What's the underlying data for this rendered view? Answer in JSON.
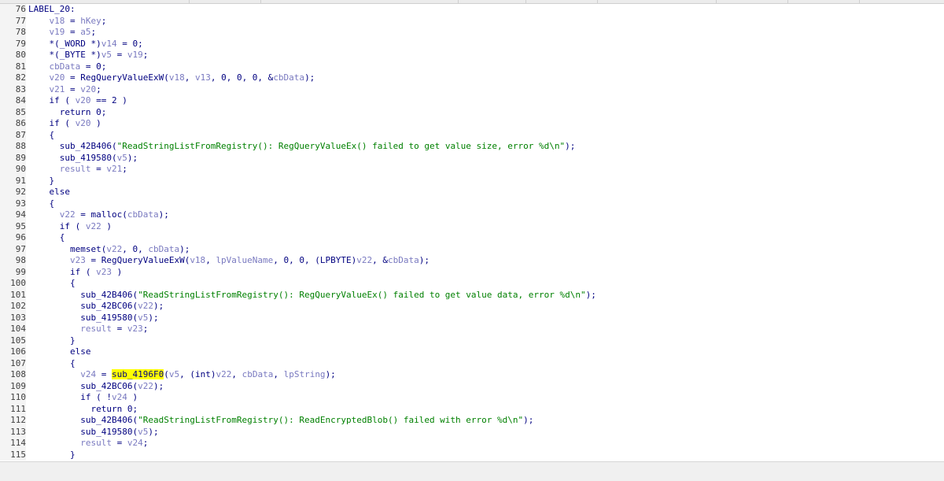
{
  "colors": {
    "string": "#008000",
    "variable": "#7a7ac0",
    "code": "#000080",
    "highlight": "#ffff00",
    "breakpoint_dot": "#3fa9e6"
  },
  "lines": [
    {
      "num": "76",
      "dot": false,
      "tokens": [
        [
          "id",
          "LABEL_20:"
        ]
      ]
    },
    {
      "num": "77",
      "dot": true,
      "tokens": [
        [
          "p",
          "    "
        ],
        [
          "var",
          "v18"
        ],
        [
          "p",
          " = "
        ],
        [
          "var",
          "hKey"
        ],
        [
          "p",
          ";"
        ]
      ]
    },
    {
      "num": "78",
      "dot": true,
      "tokens": [
        [
          "p",
          "    "
        ],
        [
          "var",
          "v19"
        ],
        [
          "p",
          " = "
        ],
        [
          "var",
          "a5"
        ],
        [
          "p",
          ";"
        ]
      ]
    },
    {
      "num": "79",
      "dot": true,
      "tokens": [
        [
          "p",
          "    *(_WORD *)"
        ],
        [
          "var",
          "v14"
        ],
        [
          "p",
          " = 0;"
        ]
      ]
    },
    {
      "num": "80",
      "dot": true,
      "tokens": [
        [
          "p",
          "    *(_BYTE *)"
        ],
        [
          "var",
          "v5"
        ],
        [
          "p",
          " = "
        ],
        [
          "var",
          "v19"
        ],
        [
          "p",
          ";"
        ]
      ]
    },
    {
      "num": "81",
      "dot": true,
      "tokens": [
        [
          "p",
          "    "
        ],
        [
          "var",
          "cbData"
        ],
        [
          "p",
          " = 0;"
        ]
      ]
    },
    {
      "num": "82",
      "dot": true,
      "tokens": [
        [
          "p",
          "    "
        ],
        [
          "var",
          "v20"
        ],
        [
          "p",
          " = RegQueryValueExW("
        ],
        [
          "var",
          "v18"
        ],
        [
          "p",
          ", "
        ],
        [
          "var",
          "v13"
        ],
        [
          "p",
          ", 0, 0, 0, &"
        ],
        [
          "var",
          "cbData"
        ],
        [
          "p",
          ");"
        ]
      ]
    },
    {
      "num": "83",
      "dot": true,
      "tokens": [
        [
          "p",
          "    "
        ],
        [
          "var",
          "v21"
        ],
        [
          "p",
          " = "
        ],
        [
          "var",
          "v20"
        ],
        [
          "p",
          ";"
        ]
      ]
    },
    {
      "num": "84",
      "dot": true,
      "tokens": [
        [
          "p",
          "    if ( "
        ],
        [
          "var",
          "v20"
        ],
        [
          "p",
          " == 2 )"
        ]
      ]
    },
    {
      "num": "85",
      "dot": true,
      "tokens": [
        [
          "p",
          "      return 0;"
        ]
      ]
    },
    {
      "num": "86",
      "dot": true,
      "tokens": [
        [
          "p",
          "    if ( "
        ],
        [
          "var",
          "v20"
        ],
        [
          "p",
          " )"
        ]
      ]
    },
    {
      "num": "87",
      "dot": false,
      "tokens": [
        [
          "p",
          "    {"
        ]
      ]
    },
    {
      "num": "88",
      "dot": true,
      "tokens": [
        [
          "p",
          "      sub_42B406("
        ],
        [
          "str",
          "\"ReadStringListFromRegistry(): RegQueryValueEx() failed to get value size, error %d\\n\""
        ],
        [
          "p",
          ");"
        ]
      ]
    },
    {
      "num": "89",
      "dot": true,
      "tokens": [
        [
          "p",
          "      sub_419580("
        ],
        [
          "var",
          "v5"
        ],
        [
          "p",
          ");"
        ]
      ]
    },
    {
      "num": "90",
      "dot": true,
      "tokens": [
        [
          "p",
          "      "
        ],
        [
          "var",
          "result"
        ],
        [
          "p",
          " = "
        ],
        [
          "var",
          "v21"
        ],
        [
          "p",
          ";"
        ]
      ]
    },
    {
      "num": "91",
      "dot": false,
      "tokens": [
        [
          "p",
          "    }"
        ]
      ]
    },
    {
      "num": "92",
      "dot": false,
      "tokens": [
        [
          "p",
          "    else"
        ]
      ]
    },
    {
      "num": "93",
      "dot": false,
      "tokens": [
        [
          "p",
          "    {"
        ]
      ]
    },
    {
      "num": "94",
      "dot": true,
      "tokens": [
        [
          "p",
          "      "
        ],
        [
          "var",
          "v22"
        ],
        [
          "p",
          " = malloc("
        ],
        [
          "var",
          "cbData"
        ],
        [
          "p",
          ");"
        ]
      ]
    },
    {
      "num": "95",
      "dot": true,
      "tokens": [
        [
          "p",
          "      if ( "
        ],
        [
          "var",
          "v22"
        ],
        [
          "p",
          " )"
        ]
      ]
    },
    {
      "num": "96",
      "dot": false,
      "tokens": [
        [
          "p",
          "      {"
        ]
      ]
    },
    {
      "num": "97",
      "dot": true,
      "tokens": [
        [
          "p",
          "        memset("
        ],
        [
          "var",
          "v22"
        ],
        [
          "p",
          ", 0, "
        ],
        [
          "var",
          "cbData"
        ],
        [
          "p",
          ");"
        ]
      ]
    },
    {
      "num": "98",
      "dot": true,
      "tokens": [
        [
          "p",
          "        "
        ],
        [
          "var",
          "v23"
        ],
        [
          "p",
          " = RegQueryValueExW("
        ],
        [
          "var",
          "v18"
        ],
        [
          "p",
          ", "
        ],
        [
          "var",
          "lpValueName"
        ],
        [
          "p",
          ", 0, 0, (LPBYTE)"
        ],
        [
          "var",
          "v22"
        ],
        [
          "p",
          ", &"
        ],
        [
          "var",
          "cbData"
        ],
        [
          "p",
          ");"
        ]
      ]
    },
    {
      "num": "99",
      "dot": true,
      "tokens": [
        [
          "p",
          "        if ( "
        ],
        [
          "var",
          "v23"
        ],
        [
          "p",
          " )"
        ]
      ]
    },
    {
      "num": "100",
      "dot": false,
      "tokens": [
        [
          "p",
          "        {"
        ]
      ]
    },
    {
      "num": "101",
      "dot": true,
      "tokens": [
        [
          "p",
          "          sub_42B406("
        ],
        [
          "str",
          "\"ReadStringListFromRegistry(): RegQueryValueEx() failed to get value data, error %d\\n\""
        ],
        [
          "p",
          ");"
        ]
      ]
    },
    {
      "num": "102",
      "dot": true,
      "tokens": [
        [
          "p",
          "          sub_42BC06("
        ],
        [
          "var",
          "v22"
        ],
        [
          "p",
          ");"
        ]
      ]
    },
    {
      "num": "103",
      "dot": true,
      "tokens": [
        [
          "p",
          "          sub_419580("
        ],
        [
          "var",
          "v5"
        ],
        [
          "p",
          ");"
        ]
      ]
    },
    {
      "num": "104",
      "dot": true,
      "tokens": [
        [
          "p",
          "          "
        ],
        [
          "var",
          "result"
        ],
        [
          "p",
          " = "
        ],
        [
          "var",
          "v23"
        ],
        [
          "p",
          ";"
        ]
      ]
    },
    {
      "num": "105",
      "dot": false,
      "tokens": [
        [
          "p",
          "        }"
        ]
      ]
    },
    {
      "num": "106",
      "dot": false,
      "tokens": [
        [
          "p",
          "        else"
        ]
      ]
    },
    {
      "num": "107",
      "dot": false,
      "tokens": [
        [
          "p",
          "        {"
        ]
      ]
    },
    {
      "num": "108",
      "dot": true,
      "tokens": [
        [
          "p",
          "          "
        ],
        [
          "var",
          "v24"
        ],
        [
          "p",
          " = "
        ],
        [
          "hl",
          "sub_4196F0"
        ],
        [
          "p",
          "("
        ],
        [
          "var",
          "v5"
        ],
        [
          "p",
          ", (int)"
        ],
        [
          "var",
          "v22"
        ],
        [
          "p",
          ", "
        ],
        [
          "var",
          "cbData"
        ],
        [
          "p",
          ", "
        ],
        [
          "var",
          "lpString"
        ],
        [
          "p",
          ");"
        ]
      ]
    },
    {
      "num": "109",
      "dot": true,
      "tokens": [
        [
          "p",
          "          sub_42BC06("
        ],
        [
          "var",
          "v22"
        ],
        [
          "p",
          ");"
        ]
      ]
    },
    {
      "num": "110",
      "dot": true,
      "tokens": [
        [
          "p",
          "          if ( !"
        ],
        [
          "var",
          "v24"
        ],
        [
          "p",
          " )"
        ]
      ]
    },
    {
      "num": "111",
      "dot": true,
      "tokens": [
        [
          "p",
          "            return 0;"
        ]
      ]
    },
    {
      "num": "112",
      "dot": true,
      "tokens": [
        [
          "p",
          "          sub_42B406("
        ],
        [
          "str",
          "\"ReadStringListFromRegistry(): ReadEncryptedBlob() failed with error %d\\n\""
        ],
        [
          "p",
          ");"
        ]
      ]
    },
    {
      "num": "113",
      "dot": true,
      "tokens": [
        [
          "p",
          "          sub_419580("
        ],
        [
          "var",
          "v5"
        ],
        [
          "p",
          ");"
        ]
      ]
    },
    {
      "num": "114",
      "dot": true,
      "tokens": [
        [
          "p",
          "          "
        ],
        [
          "var",
          "result"
        ],
        [
          "p",
          " = "
        ],
        [
          "var",
          "v24"
        ],
        [
          "p",
          ";"
        ]
      ]
    },
    {
      "num": "115",
      "dot": false,
      "tokens": [
        [
          "p",
          "        }"
        ]
      ]
    }
  ]
}
